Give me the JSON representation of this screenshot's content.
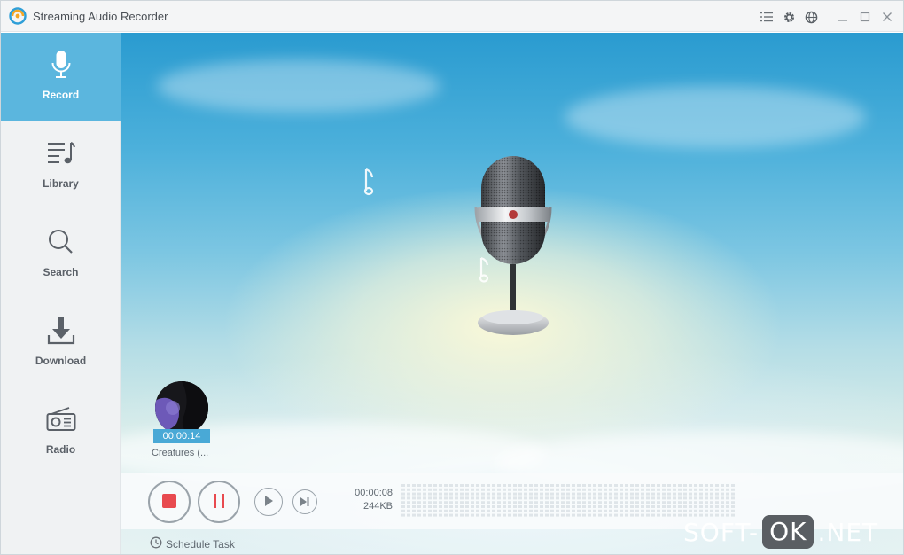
{
  "app": {
    "title": "Streaming Audio Recorder"
  },
  "titlebar": {
    "icons": [
      "menu-list-icon",
      "settings-gear-icon",
      "globe-icon",
      "minimize-icon",
      "maximize-icon",
      "close-icon"
    ]
  },
  "sidebar": {
    "items": [
      {
        "label": "Record",
        "icon": "microphone-icon",
        "active": true
      },
      {
        "label": "Library",
        "icon": "music-list-icon",
        "active": false
      },
      {
        "label": "Search",
        "icon": "search-icon",
        "active": false
      },
      {
        "label": "Download",
        "icon": "download-icon",
        "active": false
      },
      {
        "label": "Radio",
        "icon": "radio-icon",
        "active": false
      }
    ]
  },
  "colors": {
    "accent": "#5bb6de",
    "stop_red": "#e84a4f",
    "pause_red": "#e84a4f",
    "time_badge": "#49a9d6"
  },
  "current_song": {
    "elapsed": "00:00:14",
    "title": "Creatures (..."
  },
  "controls": {
    "stop": "stop-icon",
    "pause": "pause-icon",
    "play": "play-icon",
    "next": "skip-next-icon"
  },
  "recording": {
    "duration": "00:00:08",
    "size": "244KB"
  },
  "schedule": {
    "label": "Schedule Task"
  },
  "watermark": {
    "part1": "SOFT-",
    "part2": "OK",
    "part3": ".NET"
  }
}
